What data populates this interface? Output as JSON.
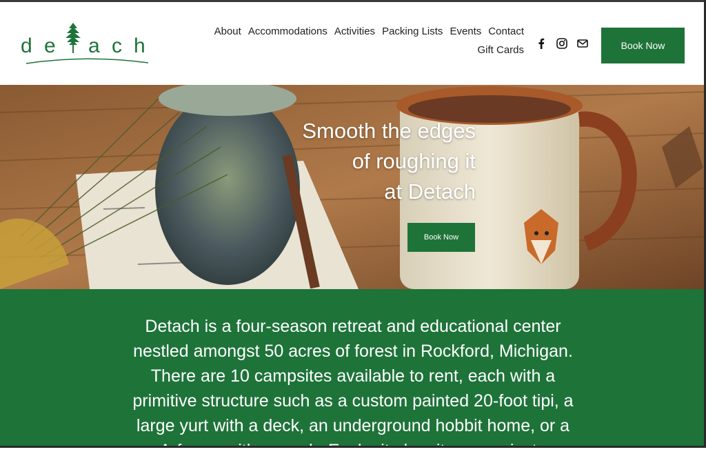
{
  "brand": {
    "logo_text": "detach",
    "logo_letters": [
      "d",
      "e",
      "t",
      "a",
      "c",
      "h"
    ]
  },
  "nav": {
    "row1": [
      "About",
      "Accommodations",
      "Activities",
      "Packing Lists",
      "Events",
      "Contact"
    ],
    "row2": [
      "Gift Cards"
    ]
  },
  "social": {
    "icons": [
      "facebook-icon",
      "instagram-icon",
      "email-icon"
    ]
  },
  "header": {
    "book_label": "Book Now"
  },
  "hero": {
    "lines": [
      "Smooth the edges",
      "of roughing it",
      "at Detach"
    ],
    "book_label": "Book Now"
  },
  "intro": {
    "lines": [
      "Detach is a four-season retreat and educational center",
      "nestled amongst 50 acres of forest in Rockford, Michigan.",
      "There are 10 campsites available to rent, each with a",
      "primitive structure such as a custom painted 20-foot tipi, a",
      "large yurt with a deck, an underground hobbit home, or a",
      "A-frame with a porch. Each site has its own private"
    ]
  },
  "colors": {
    "brand_green": "#1e7339",
    "text_dark": "#1f1f1f"
  }
}
